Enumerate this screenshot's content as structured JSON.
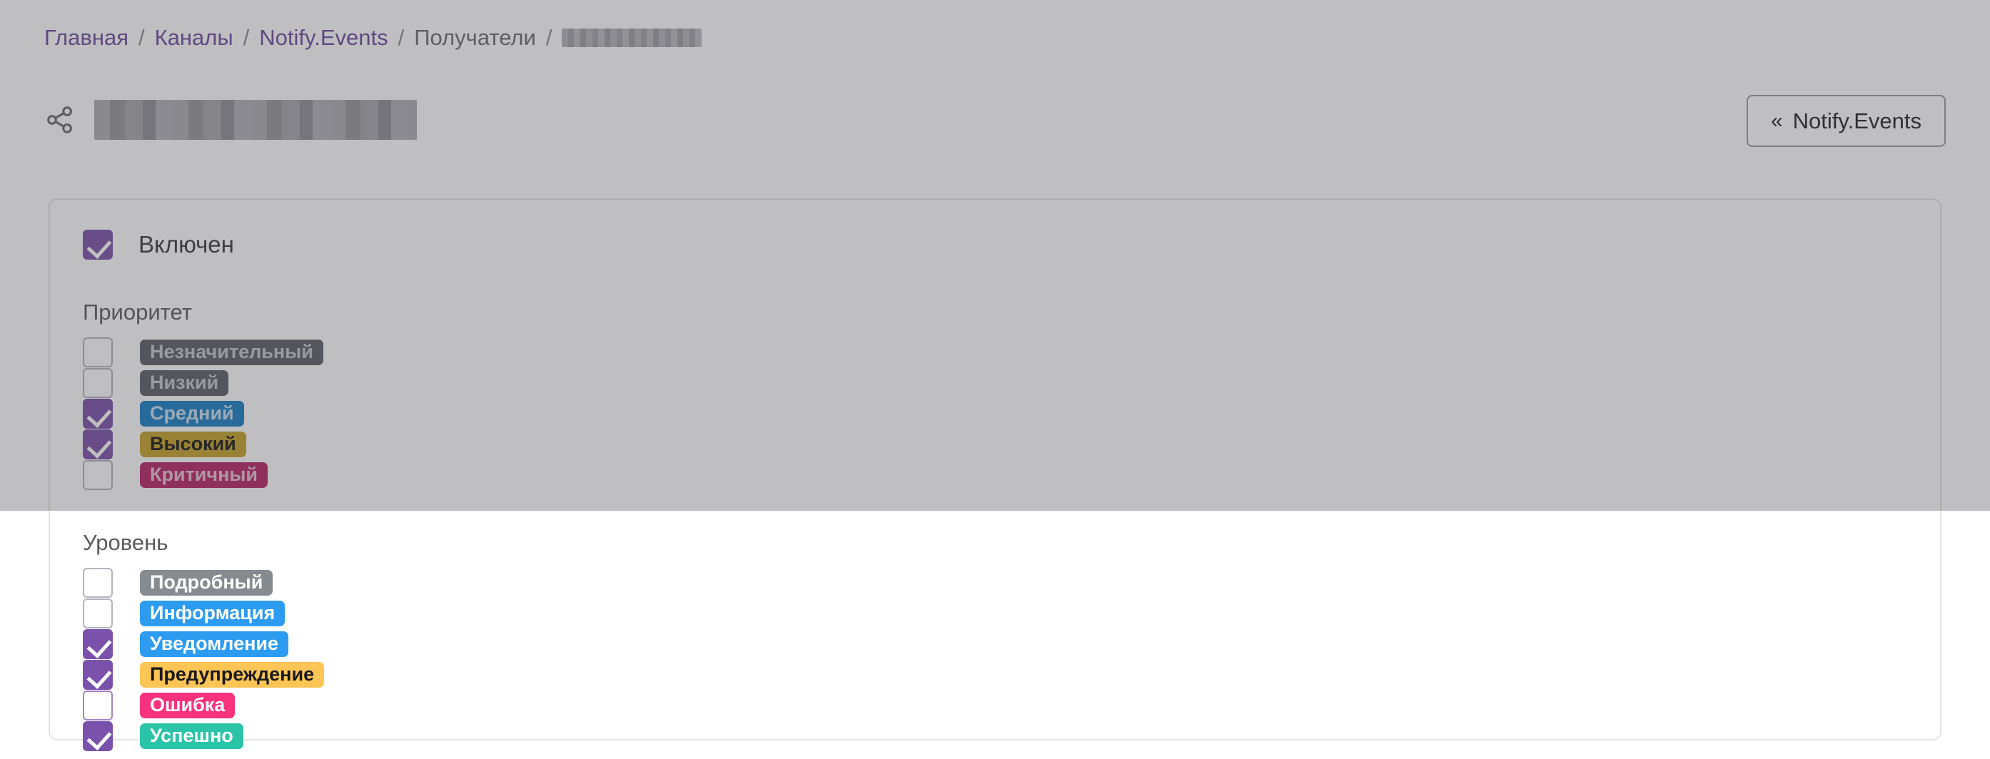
{
  "breadcrumb": {
    "items": [
      {
        "label": "Главная",
        "type": "link"
      },
      {
        "label": "Каналы",
        "type": "link"
      },
      {
        "label": "Notify.Events",
        "type": "link"
      },
      {
        "label": "Получатели",
        "type": "static"
      },
      {
        "label": "",
        "type": "redacted"
      }
    ],
    "separator": "/"
  },
  "header": {
    "icon": "share-icon",
    "title_redacted": "",
    "back_button": {
      "chevron": "«",
      "label": "Notify.Events"
    }
  },
  "card": {
    "enabled": {
      "label": "Включен",
      "checked": true
    },
    "priority": {
      "title": "Приоритет",
      "options": [
        {
          "label": "Незначительный",
          "checked": false,
          "bg": "#5b6268",
          "fg": "#c4c7ca"
        },
        {
          "label": "Низкий",
          "checked": false,
          "bg": "#5b6268",
          "fg": "#c4c7ca"
        },
        {
          "label": "Средний",
          "checked": true,
          "bg": "#1b7fc4",
          "fg": "#c9dff0"
        },
        {
          "label": "Высокий",
          "checked": true,
          "bg": "#c6a32c",
          "fg": "#191919"
        },
        {
          "label": "Критичный",
          "checked": false,
          "bg": "#b62766",
          "fg": "#e9c3d4"
        }
      ]
    },
    "level": {
      "title": "Уровень",
      "options": [
        {
          "label": "Подробный",
          "checked": false,
          "accent_border": false,
          "bg": "#868b90",
          "fg": "#ffffff"
        },
        {
          "label": "Информация",
          "checked": false,
          "accent_border": false,
          "bg": "#2d9bf0",
          "fg": "#ffffff"
        },
        {
          "label": "Уведомление",
          "checked": true,
          "accent_border": false,
          "bg": "#2d9bf0",
          "fg": "#ffffff"
        },
        {
          "label": "Предупреждение",
          "checked": true,
          "accent_border": false,
          "bg": "#fdc košik",
          "fg": "#191919"
        },
        {
          "label": "Ошибка",
          "checked": false,
          "accent_border": true,
          "bg": "#f9327e",
          "fg": "#ffffff"
        },
        {
          "label": "Успешно",
          "checked": true,
          "accent_border": false,
          "bg": "#2bc4a8",
          "fg": "#ffffff"
        }
      ]
    }
  },
  "colors": {
    "accent_purple": "#7b52ab",
    "link_purple": "#6f4ba0",
    "overlay": "rgba(68,68,72,0.34)",
    "card_bg": "#ffffff",
    "page_bg": "#ffffff"
  }
}
